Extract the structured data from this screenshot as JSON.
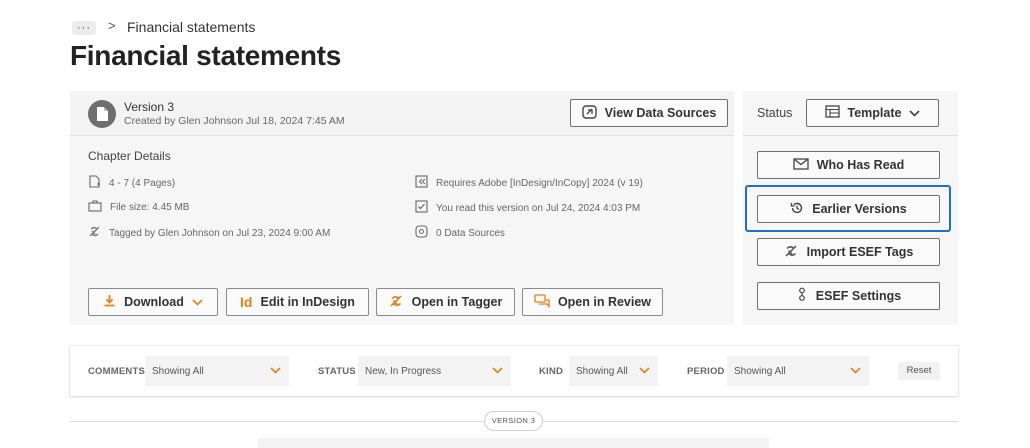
{
  "breadcrumb": {
    "more_label": "···",
    "separator": ">",
    "current": "Financial statements"
  },
  "page": {
    "title": "Financial statements"
  },
  "version_card": {
    "version_title": "Version 3",
    "created_by": "Created by Glen Johnson Jul 18, 2024 7:45 AM",
    "view_data_sources_label": "View Data Sources",
    "chapter_details_label": "Chapter Details",
    "details": {
      "pages": "4 - 7 (4 Pages)",
      "file_size": "File size: 4.45 MB",
      "tagged_by": "Tagged by Glen Johnson on Jul 23, 2024 9:00 AM",
      "requires": "Requires Adobe [InDesign/InCopy] 2024 (v 19)",
      "you_read": "You read this version on Jul 24, 2024 4:03 PM",
      "data_sources": "0 Data Sources"
    },
    "actions": {
      "download": "Download",
      "edit_indesign": "Edit in InDesign",
      "open_tagger": "Open in Tagger",
      "open_review": "Open in Review"
    }
  },
  "side_panel": {
    "status_label": "Status",
    "status_value": "Template",
    "buttons": {
      "who_has_read": "Who Has Read",
      "earlier_versions": "Earlier Versions",
      "import_esef_tags": "Import ESEF Tags",
      "esef_settings": "ESEF Settings"
    }
  },
  "filters": {
    "comments_label": "COMMENTS",
    "comments_value": "Showing All",
    "status_label": "STATUS",
    "status_value": "New, In Progress",
    "kind_label": "KIND",
    "kind_value": "Showing All",
    "period_label": "PERIOD",
    "period_value": "Showing All",
    "reset_label": "Reset"
  },
  "version_divider": {
    "label": "VERSION 3"
  },
  "colors": {
    "accent_orange": "#e8801a",
    "focus_blue": "#1f6fcf",
    "panel_bg": "#f6f6f6"
  },
  "icons": {
    "more": "ellipsis-icon",
    "doc": "document-icon",
    "data_sources": "link-icon",
    "download": "download-icon",
    "indesign": "indesign-icon",
    "tagger": "tag-icon",
    "review": "comment-icon",
    "template": "template-icon",
    "who_has_read": "envelope-icon",
    "earlier_versions": "history-icon",
    "import_esef": "tag-icon",
    "esef_settings": "settings-icon"
  }
}
